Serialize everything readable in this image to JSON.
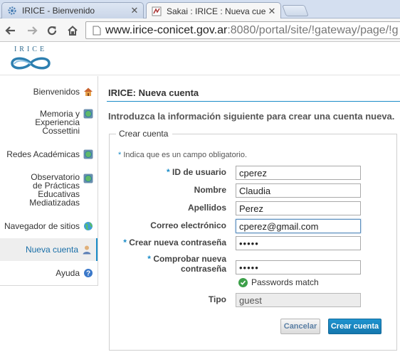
{
  "browser": {
    "tabs": [
      {
        "title": "IRICE - Bienvenido",
        "favicon": "gear-icon",
        "active": false
      },
      {
        "title": "Sakai : IRICE : Nueva cuent",
        "favicon": "sakai-icon",
        "active": true
      }
    ],
    "url": {
      "host": "www.irice-conicet.gov.ar",
      "rest": ":8080/portal/site/!gateway/page/!g"
    }
  },
  "site": {
    "logo_text": "IRICE"
  },
  "sidebar": {
    "items": [
      {
        "label": "Bienvenidos",
        "icon": "home-icon",
        "active": false
      },
      {
        "label": "Memoria y Experiencia Cossettini",
        "icon": "globe-icon",
        "active": false
      },
      {
        "label": "Redes Académicas",
        "icon": "globe-icon",
        "active": false
      },
      {
        "label": "Observatorio de Prácticas Educativas Mediatizadas",
        "icon": "globe-icon",
        "active": false
      },
      {
        "label": "Navegador de sitios",
        "icon": "globe-green-icon",
        "active": false
      },
      {
        "label": "Nueva cuenta",
        "icon": "user-icon",
        "active": true
      },
      {
        "label": "Ayuda",
        "icon": "help-icon",
        "active": false
      }
    ]
  },
  "main": {
    "title": "IRICE: Nueva cuenta",
    "intro": "Introduzca la información siguiente para crear una cuenta nueva.",
    "legend": "Crear cuenta",
    "required_note": "Indica que es un campo obligatorio.",
    "required_star": "*",
    "fields": {
      "user_id": {
        "label": "ID de usuario",
        "value": "cperez",
        "required": true
      },
      "first_name": {
        "label": "Nombre",
        "value": "Claudia",
        "required": false
      },
      "last_name": {
        "label": "Apellidos",
        "value": "Perez",
        "required": false
      },
      "email": {
        "label": "Correo electrónico",
        "value": "cperez@gmail.com",
        "required": false
      },
      "password": {
        "label": "Crear nueva contraseña",
        "value": "•••••",
        "required": true
      },
      "password_confirm": {
        "label": "Comprobar nueva contraseña",
        "value": "•••••",
        "required": true
      },
      "type": {
        "label": "Tipo",
        "value": "guest",
        "required": false
      }
    },
    "password_match": "Passwords match",
    "buttons": {
      "cancel": "Cancelar",
      "create": "Crear cuenta"
    }
  },
  "colors": {
    "accent": "#1a8cc8",
    "success": "#3da04a"
  }
}
